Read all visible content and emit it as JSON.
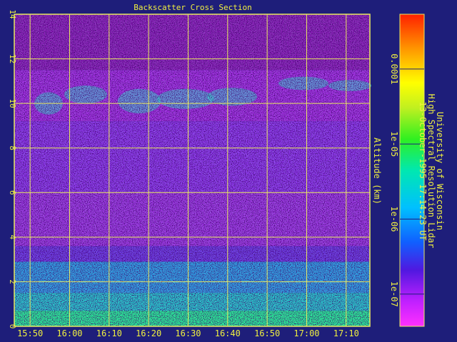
{
  "chart_data": {
    "type": "heatmap",
    "title": "Backscatter Cross Section",
    "ylabel": "Altitude (km)",
    "y_axis": {
      "range": [
        0,
        14
      ],
      "ticks": [
        0,
        2,
        4,
        6,
        8,
        10,
        12,
        14
      ]
    },
    "x_axis": {
      "range": [
        "15:46",
        "17:16"
      ],
      "ticks": [
        "15:50",
        "16:00",
        "16:10",
        "16:20",
        "16:30",
        "16:40",
        "16:50",
        "17:00",
        "17:10"
      ]
    },
    "grid": true,
    "colorbar": {
      "scale": "log",
      "ticks": [
        "1e-07",
        "1e-06",
        "1e-05",
        "0.0001"
      ]
    },
    "info": {
      "line1": "University of Wisconsin",
      "line2": "High Spectral Resolution Lidar",
      "line3": "13-October-1995 17:14:23 UT"
    },
    "colors": {
      "background": "#1e1e7a",
      "axis": "#f0f040",
      "grid": "#e8e860",
      "text": "#f0f040"
    }
  }
}
